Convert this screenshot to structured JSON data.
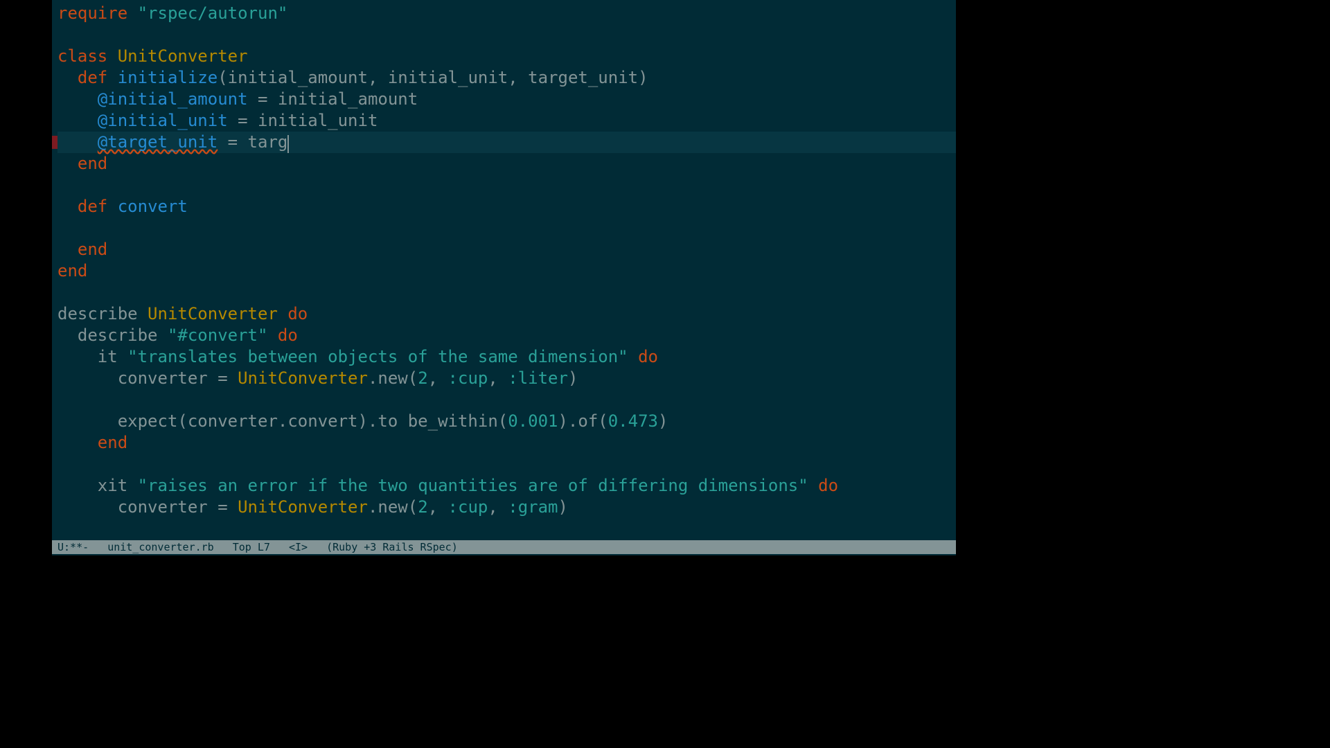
{
  "code": {
    "lines": [
      {
        "type": "require",
        "keyword": "require",
        "string": "\"rspec/autorun\""
      },
      {
        "type": "blank"
      },
      {
        "type": "class_def",
        "keyword": "class",
        "name": "UnitConverter"
      },
      {
        "type": "method_def",
        "indent": 1,
        "keyword": "def",
        "name": "initialize",
        "params": "(initial_amount, initial_unit, target_unit)"
      },
      {
        "type": "ivar_assign",
        "indent": 2,
        "ivar": "@initial_amount",
        "op": " = ",
        "value": "initial_amount"
      },
      {
        "type": "ivar_assign",
        "indent": 2,
        "ivar": "@initial_unit",
        "op": " = ",
        "value": "initial_unit"
      },
      {
        "type": "ivar_assign_current",
        "indent": 2,
        "ivar": "@target_unit",
        "op": " = ",
        "value": "targ",
        "wavy": true
      },
      {
        "type": "end",
        "indent": 1,
        "text": "end"
      },
      {
        "type": "blank"
      },
      {
        "type": "method_def",
        "indent": 1,
        "keyword": "def",
        "name": "convert",
        "params": ""
      },
      {
        "type": "blank"
      },
      {
        "type": "end",
        "indent": 1,
        "text": "end"
      },
      {
        "type": "end",
        "indent": 0,
        "text": "end"
      },
      {
        "type": "blank"
      },
      {
        "type": "describe_const",
        "indent": 0,
        "keyword": "describe",
        "const": "UnitConverter",
        "do": "do"
      },
      {
        "type": "describe_str",
        "indent": 1,
        "keyword": "describe",
        "string": "\"#convert\"",
        "do": "do"
      },
      {
        "type": "it",
        "indent": 2,
        "keyword": "it",
        "string": "\"translates between objects of the same dimension\"",
        "do": "do"
      },
      {
        "type": "assign_new",
        "indent": 3,
        "var": "converter = ",
        "const": "UnitConverter",
        "method": ".new(",
        "num": "2",
        "sep1": ", ",
        "sym1": ":cup",
        "sep2": ", ",
        "sym2": ":liter",
        "close": ")"
      },
      {
        "type": "blank"
      },
      {
        "type": "expect",
        "indent": 3,
        "text1": "expect(converter.convert).to be_within(",
        "num1": "0.001",
        "text2": ").of(",
        "num2": "0.473",
        "text3": ")"
      },
      {
        "type": "end",
        "indent": 2,
        "text": "end"
      },
      {
        "type": "blank"
      },
      {
        "type": "it",
        "indent": 2,
        "keyword": "xit",
        "string": "\"raises an error if the two quantities are of differing dimensions\"",
        "do": "do"
      },
      {
        "type": "assign_new",
        "indent": 3,
        "var": "converter = ",
        "const": "UnitConverter",
        "method": ".new(",
        "num": "2",
        "sep1": ", ",
        "sym1": ":cup",
        "sep2": ", ",
        "sym2": ":gram",
        "close": ")"
      }
    ]
  },
  "statusbar": {
    "modified": "U:**-",
    "filename": "unit_converter.rb",
    "position": "Top L7",
    "mode": "<I>",
    "modes": "(Ruby +3 Rails RSpec)"
  },
  "current_line_index": 6
}
